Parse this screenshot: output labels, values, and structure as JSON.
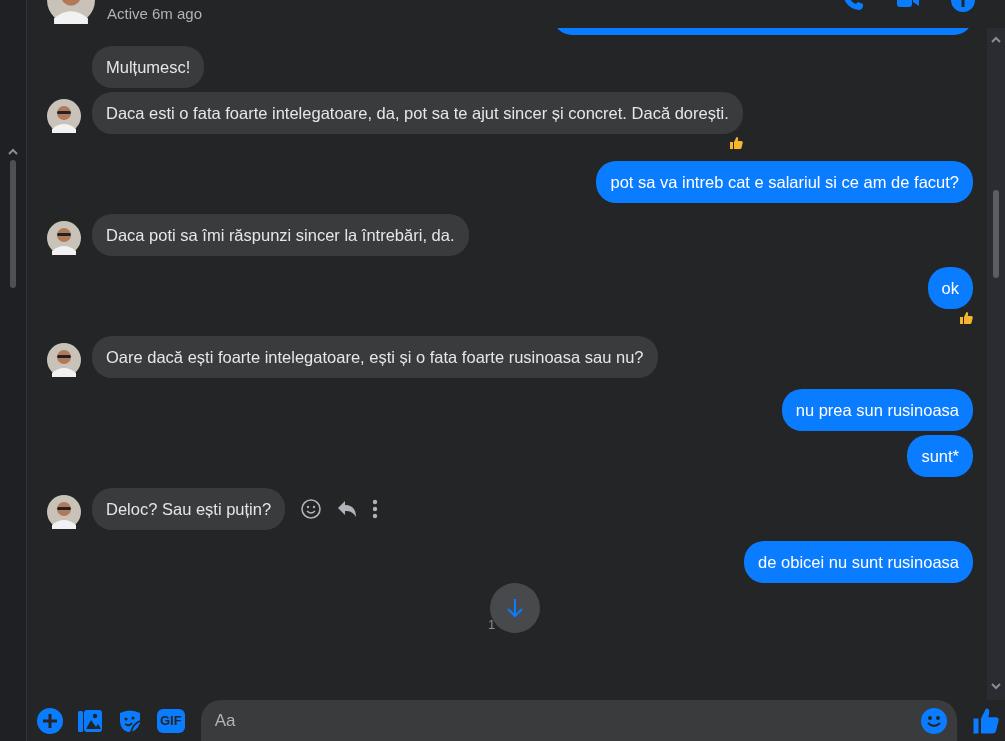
{
  "header": {
    "status": "Active 6m ago"
  },
  "messages": [
    {
      "kind": "partial"
    },
    {
      "kind": "received",
      "text": "Mulțumesc!",
      "avatar": false,
      "reacted": false,
      "hovered": false
    },
    {
      "kind": "received",
      "text": "Daca esti o fata foarte intelegatoare, da, pot sa te ajut sincer și concret. Dacă dorești.",
      "avatar": true,
      "reacted": true,
      "hovered": false
    },
    {
      "kind": "sent",
      "text": "pot sa va intreb cat e salariul si ce am de facut?",
      "avatar": false,
      "reacted": false,
      "hovered": false
    },
    {
      "kind": "received",
      "text": "Daca poti sa îmi răspunzi sincer la întrebări, da.",
      "avatar": true,
      "reacted": false,
      "hovered": false
    },
    {
      "kind": "sent",
      "text": "ok",
      "avatar": false,
      "reacted": true,
      "hovered": false
    },
    {
      "kind": "received",
      "text": "Oare dacă ești foarte intelegatoare, ești și o fata foarte rusinoasa sau nu?",
      "avatar": true,
      "reacted": false,
      "hovered": false
    },
    {
      "kind": "sent",
      "text": "nu prea sun rusinoasa",
      "avatar": false,
      "reacted": false,
      "hovered": false
    },
    {
      "kind": "sent",
      "text": "sunt*",
      "avatar": false,
      "reacted": false,
      "hovered": false
    },
    {
      "kind": "received",
      "text": "Deloc? Sau ești puțin?",
      "avatar": true,
      "reacted": false,
      "hovered": true
    },
    {
      "kind": "sent",
      "text": "de obicei nu sunt rusinoasa",
      "avatar": false,
      "reacted": false,
      "hovered": false
    }
  ],
  "covered_text": "1",
  "composer": {
    "gif_label": "GIF",
    "placeholder": "Aa"
  }
}
